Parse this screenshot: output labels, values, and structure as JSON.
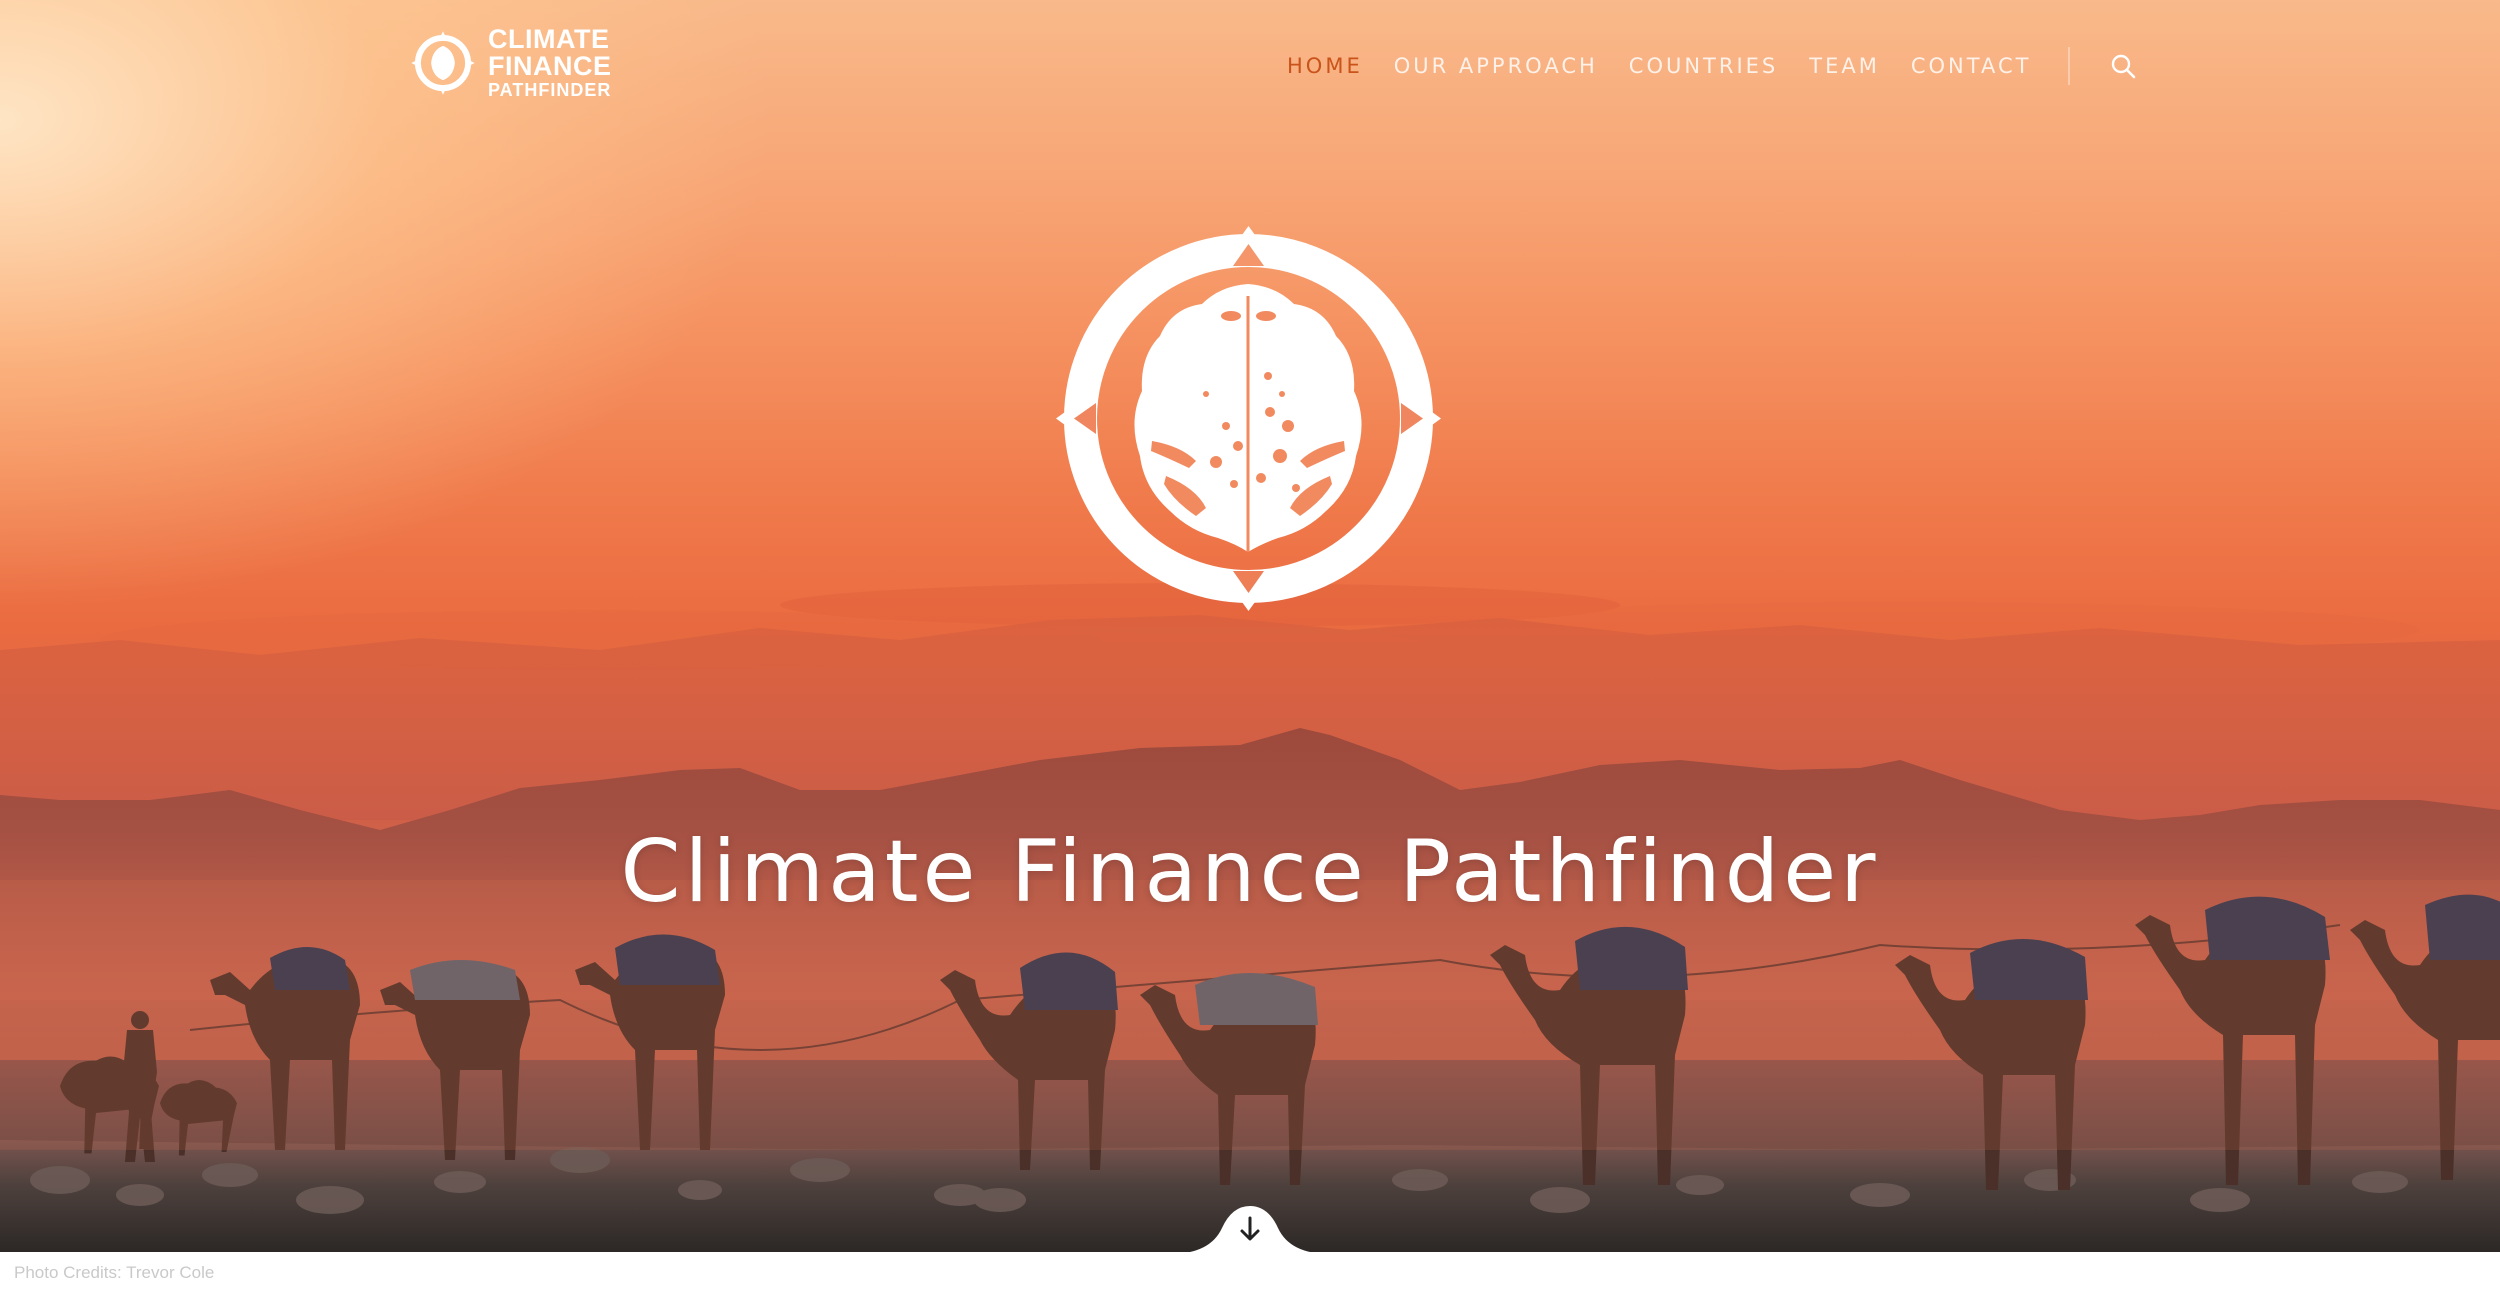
{
  "brand": {
    "line1": "CLIMATE",
    "line2": "FINANCE",
    "line3": "PATHFINDER",
    "logo_icon": "leaf-compass-icon"
  },
  "nav": {
    "items": [
      {
        "label": "HOME",
        "active": true
      },
      {
        "label": "OUR APPROACH",
        "active": false
      },
      {
        "label": "COUNTRIES",
        "active": false
      },
      {
        "label": "TEAM",
        "active": false
      },
      {
        "label": "CONTACT",
        "active": false
      }
    ],
    "search_icon": "search-icon"
  },
  "hero": {
    "title": "Climate Finance Pathfinder",
    "emblem_icon": "leaf-compass-icon",
    "scroll_icon": "arrow-down-icon"
  },
  "footer": {
    "credits": "Photo Credits: Trevor Cole"
  },
  "colors": {
    "accent": "#c9531a",
    "nav_text": "#ffffff",
    "sky_top": "#f9b98a",
    "sky_mid": "#ea6b40",
    "ground": "#3f3a38"
  }
}
